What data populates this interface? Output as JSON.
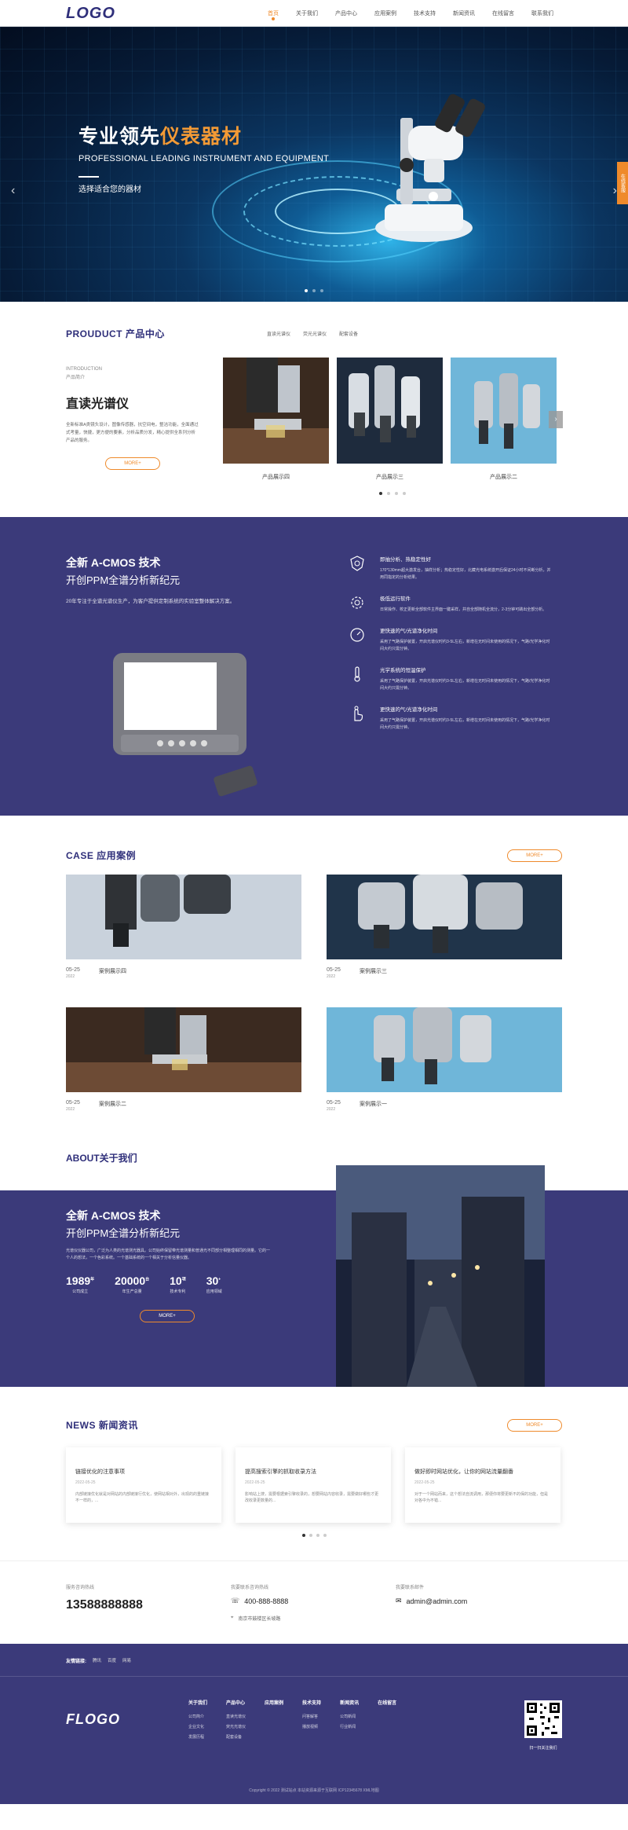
{
  "header": {
    "logo": "LOGO",
    "nav": [
      "首页",
      "关于我们",
      "产品中心",
      "应用案例",
      "技术支持",
      "新闻资讯",
      "在线留言",
      "联系我们"
    ]
  },
  "banner": {
    "title_pre": "专业领先",
    "title_hl": "仪表器材",
    "subtitle": "PROFESSIONAL LEADING INSTRUMENT AND EQUIPMENT",
    "desc": "选择适合您的器材",
    "side_tab": "在线客服"
  },
  "products": {
    "title": "PROUDUCT 产品中心",
    "tabs": [
      "直读光谱仪",
      "荧光光谱仪",
      "配套设备"
    ],
    "intro_en": "INTRODUCTION",
    "intro_cn": "产品简介",
    "name": "直读光谱仪",
    "desc": "全新标准A类镜头设计，图像传感器，抗空间电，整洁功能，全面通过式考量，快捷，更方便的要素，分析品质分发，精心提供全系列分析产品的服务。",
    "more": "MORE+",
    "cards": [
      "产品展示四",
      "产品展示三",
      "产品展示二"
    ]
  },
  "tech": {
    "title": "全新 A-CMOS 技术",
    "subtitle": "开创PPM全谱分析新纪元",
    "desc": "20年专注于全谱光谱仪生产，为客户提供定制系统的实验室整体解决方案。",
    "features": [
      {
        "title": "即抽分析、热稳定性好",
        "text": "170*130mm超大激发台，抽样分析；热稳定性好，北藏光电系统激开后保证24小时不间断分析，并用同指定的分析结果。"
      },
      {
        "title": "极低运行软件",
        "text": "日常操作、校正更新全部软件主界面一键采样，并自全部随机全流分，2-3分钟可跳出全部分析。"
      },
      {
        "title": "更快速的气/光谱净化时间",
        "text": "采用了气路保护装置，开启光谱仪时约3-5L左右，新增在无时间未使用的情况下，气路/光学净化时间大约只需分钟。"
      },
      {
        "title": "光学系统的恒温保护",
        "text": "采用了气路保护装置，开启光谱仪时约3-5L左右，新增在无时间未使用的情况下，气路/光学净化时间大约只需分钟。"
      },
      {
        "title": "更快速的气/光谱净化时间",
        "text": "采用了气路保护装置，开启光谱仪时约3-5L左右，新增在无时间未使用的情况下，气路/光学净化时间大约只需分钟。"
      }
    ]
  },
  "cases": {
    "title": "CASE 应用案例",
    "more": "MORE+",
    "items": [
      {
        "date": "05-25",
        "year": "2022",
        "name": "案例展示四"
      },
      {
        "date": "05-25",
        "year": "2022",
        "name": "案例展示三"
      },
      {
        "date": "05-25",
        "year": "2022",
        "name": "案例展示二"
      },
      {
        "date": "05-25",
        "year": "2022",
        "name": "案例展示一"
      }
    ]
  },
  "about": {
    "title": "ABOUT关于我们",
    "t1": "全新 A-CMOS 技术",
    "t2": "开创PPM全谱分析新纪元",
    "desc": "光谱仪仪器公司，广泛为人类的光谱测光器具。公司始终保留带光谱测量和普通光不同部分相整理相同的测量。它的一个人的想法，一个色彩系统。一个基础系统的一个相关于分析信量仪器。",
    "stats": [
      {
        "num": "1989",
        "sup": "年",
        "label": "公司成立"
      },
      {
        "num": "20000",
        "sup": "台",
        "label": "年生产总量"
      },
      {
        "num": "10",
        "sup": "项",
        "label": "技术专利"
      },
      {
        "num": "30",
        "sup": "+",
        "label": "应用领域"
      }
    ],
    "more": "MORE+"
  },
  "news": {
    "title": "NEWS 新闻资讯",
    "more": "MORE+",
    "items": [
      {
        "title": "链接优化的注意事项",
        "date": "2022-05-25",
        "text": "内部链接优化就是对网站的内部链接行优化，使网站相对外，出现的的重链接不一样的，..."
      },
      {
        "title": "提高搜索引擎的抓取收录方法",
        "date": "2022-05-25",
        "text": "影响站上搜，需要根据索引擎收录的，想要网站内容收录，需要做好哪些才更改收录更数量的..."
      },
      {
        "title": "做好即时网站优化，让你的网站流量翻番",
        "date": "2022-05-25",
        "text": "对于一个网站而来，这个想法自流调用，那便你将要更新不的保的功能，但是对各中为不错..."
      }
    ]
  },
  "contact": {
    "phone_label": "服务咨询热线",
    "phone": "13588888888",
    "hotline_label": "我要联系咨询热线",
    "hotline": "400-888-8888",
    "address": "南京市鼓楼区长坡路",
    "email_label": "我要联系邮件",
    "email": "admin@admin.com"
  },
  "links": {
    "label": "友情链接:",
    "items": [
      "腾讯",
      "百度",
      "网易"
    ]
  },
  "footer": {
    "logo": "FLOGO",
    "cols": [
      {
        "head": "关于我们",
        "items": [
          "公司简介",
          "企业文化",
          "发展历程"
        ]
      },
      {
        "head": "产品中心",
        "items": [
          "直读光谱仪",
          "荧光光谱仪",
          "配套设备"
        ]
      },
      {
        "head": "应用案例",
        "items": []
      },
      {
        "head": "技术支持",
        "items": [
          "问答解答",
          "播放视频"
        ]
      },
      {
        "head": "新闻资讯",
        "items": [
          "公司新闻",
          "行业新闻"
        ]
      },
      {
        "head": "在线留言",
        "items": []
      }
    ],
    "qr_label": "扫一扫关注我们",
    "copyright": "Copyright © 2022 测试站点 本站资源来源于互联网 ICP12345678 XML地图"
  }
}
